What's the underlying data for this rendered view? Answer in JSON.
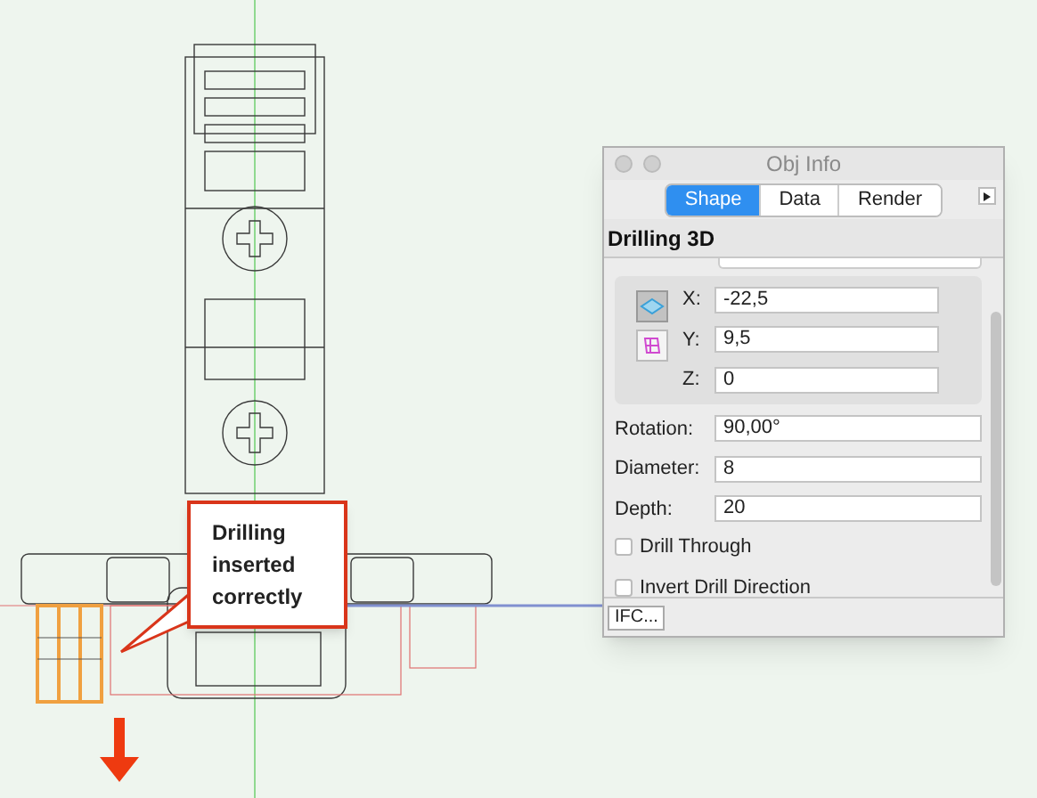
{
  "canvas": {
    "callout": "Drilling inserted correctly"
  },
  "window": {
    "title": "Obj Info"
  },
  "tabs": [
    {
      "label": "Shape",
      "selected": true
    },
    {
      "label": "Data",
      "selected": false
    },
    {
      "label": "Render",
      "selected": false
    }
  ],
  "object_type": "Drilling 3D",
  "view_buttons": [
    {
      "kind": "top",
      "selected": true
    },
    {
      "kind": "front",
      "selected": false
    }
  ],
  "position_fields": [
    {
      "label": "X:",
      "value": "-22,5"
    },
    {
      "label": "Y:",
      "value": "9,5"
    },
    {
      "label": "Z:",
      "value": "0"
    }
  ],
  "fields": [
    {
      "label": "Rotation:",
      "value": "90,00°"
    },
    {
      "label": "Diameter:",
      "value": "8"
    },
    {
      "label": "Depth:",
      "value": "20"
    }
  ],
  "checkboxes": [
    {
      "label": "Drill Through",
      "checked": false
    },
    {
      "label": "Invert Drill Direction",
      "checked": false
    }
  ],
  "footer_button": "IFC..."
}
